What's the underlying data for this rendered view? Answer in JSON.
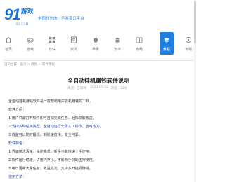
{
  "brand": {
    "logo_number": "91",
    "logo_text": "游戏",
    "logo_subtext": "91.COM",
    "tagline": "中国领先的 · 手游资讯平台",
    "accent_color": "#1e7fe0"
  },
  "nav": {
    "items": [
      {
        "label": "首页",
        "icon": "home-icon"
      },
      {
        "label": "游戏",
        "icon": "gamepad-icon"
      },
      {
        "label": "软件",
        "icon": "app-icon"
      },
      {
        "label": "资讯",
        "icon": "news-icon"
      },
      {
        "label": "苹果",
        "icon": "apple-icon"
      },
      {
        "label": "安卓",
        "icon": "android-icon"
      },
      {
        "label": "攻略",
        "icon": "guide-icon"
      },
      {
        "label": "教程",
        "icon": "tutorial-icon",
        "active": true
      },
      {
        "label": "专题",
        "icon": "topic-icon"
      }
    ]
  },
  "breadcrumb": "当前位置：首页 > 教程 > 软件教程",
  "article": {
    "title": "全自动挂机赚钱软件说明",
    "meta": {
      "source": "来源：互联网",
      "date": "2023-05-18",
      "views": "浏览：128"
    },
    "paragraphs": [
      {
        "text": "全自动挂机赚钱软件是一款帮助用户挂机赚钱的工具。",
        "style": "normal"
      },
      {
        "text": "软件介绍：",
        "style": "normal"
      },
      {
        "text": "1.用户只需打开软件即可自动完成任务，轻松获取收益。",
        "style": "normal"
      },
      {
        "text": "2.支持多种任务类型，全自动运行无需人工操作，省时省力。",
        "style": "emphasis"
      },
      {
        "text": "3.收益可以随时提现，到账速度快，安全可靠。",
        "style": "normal"
      },
      {
        "text": "软件特色：",
        "style": "emphasis"
      },
      {
        "text": "1.界面简洁清晰，操作简单，新手也能快速上手使用。",
        "style": "normal"
      },
      {
        "text": "2.软件运行稳定，占用内存小，不影响手机的正常使用。",
        "style": "normal"
      },
      {
        "text": "3.每日更新大量任务，收益稳定，支持多开挂机赚钱。",
        "style": "normal"
      },
      {
        "text": "使用方法：",
        "style": "emphasis"
      }
    ]
  }
}
